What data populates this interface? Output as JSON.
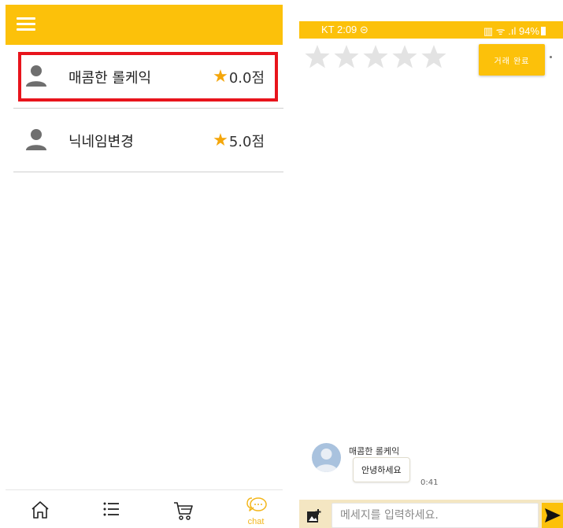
{
  "left_screen": {
    "chat_list": [
      {
        "name": "매콤한 롤케익",
        "rating": "0.0점",
        "highlighted": true
      },
      {
        "name": "닉네임변경",
        "rating": "5.0점",
        "highlighted": false
      }
    ],
    "nav": {
      "home": "home-icon",
      "list": "list-icon",
      "cart": "cart-icon",
      "chat_label": "chat"
    }
  },
  "right_screen": {
    "status": {
      "left": "KT 2:09 ⊝",
      "right": "▥ ᯤ .ıl 94%"
    },
    "rating_stars": 5,
    "complete_button": "거래 완료",
    "message": {
      "sender": "매콤한 롤케익",
      "text": "안녕하세요",
      "time": "0:41"
    },
    "input_placeholder": "메세지를 입력하세요."
  },
  "colors": {
    "accent": "#fcc10a",
    "highlight": "#e8141c",
    "star": "#f4a60a"
  }
}
